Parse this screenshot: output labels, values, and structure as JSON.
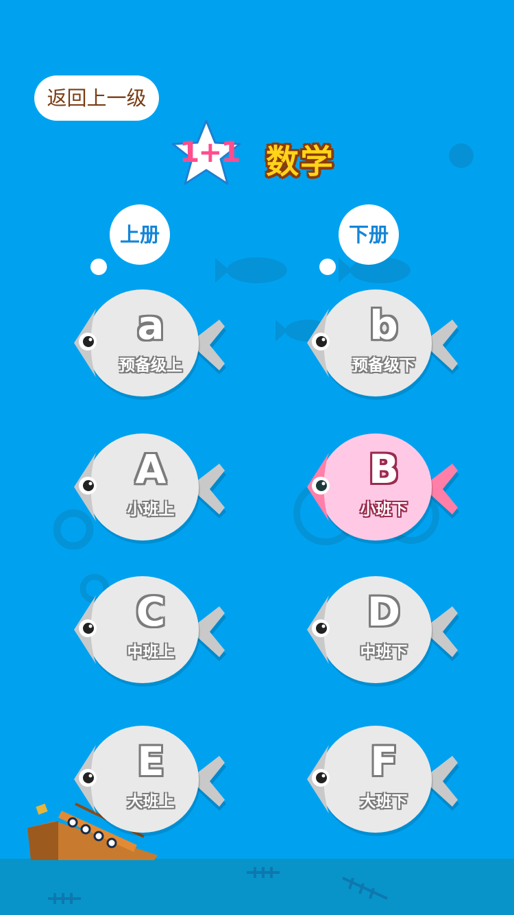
{
  "header": {
    "back_label": "返回上一级",
    "logo_mark": "1+1",
    "subject_title": "数学"
  },
  "volumes": {
    "upper": "上册",
    "lower": "下册"
  },
  "levels": [
    {
      "letter": "a",
      "label": "预备级上",
      "selected": false
    },
    {
      "letter": "b",
      "label": "预备级下",
      "selected": false
    },
    {
      "letter": "A",
      "label": "小班上",
      "selected": false
    },
    {
      "letter": "B",
      "label": "小班下",
      "selected": true
    },
    {
      "letter": "C",
      "label": "中班上",
      "selected": false
    },
    {
      "letter": "D",
      "label": "中班下",
      "selected": false
    },
    {
      "letter": "E",
      "label": "大班上",
      "selected": false
    },
    {
      "letter": "F",
      "label": "大班下",
      "selected": false
    }
  ],
  "colors": {
    "background": "#00a2f0",
    "fish_default": "#e9e9e9",
    "fish_selected": "#ffc9e6",
    "back_text": "#7a3b12",
    "volume_text": "#1485d6"
  }
}
